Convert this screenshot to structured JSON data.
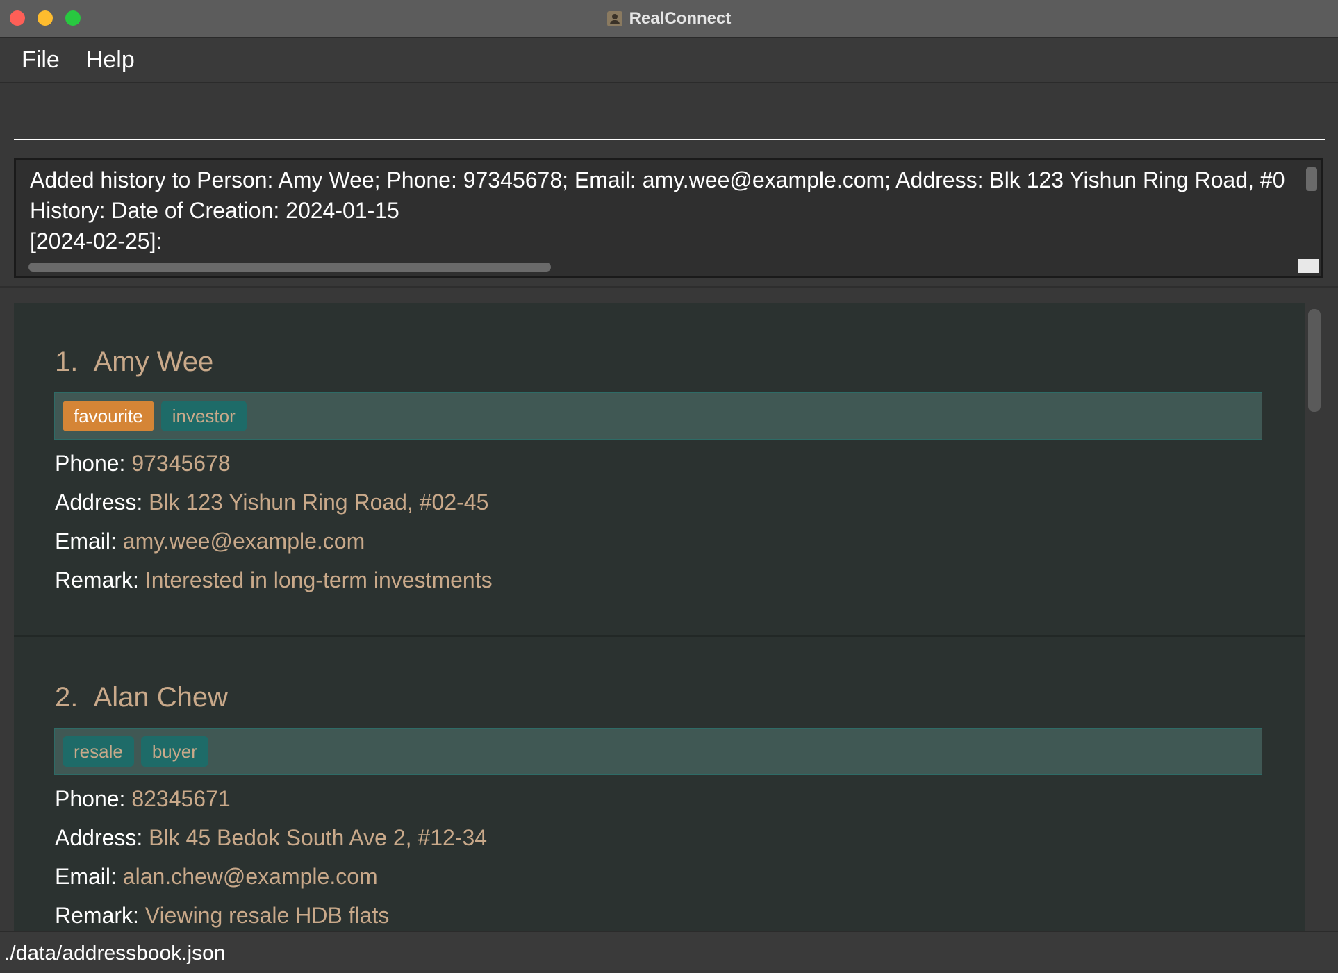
{
  "window": {
    "title": "RealConnect"
  },
  "menu": {
    "items": [
      "File",
      "Help"
    ]
  },
  "command_box": {
    "value": "",
    "placeholder": ""
  },
  "result": {
    "lines": [
      "Added history to Person: Amy Wee; Phone: 97345678; Email: amy.wee@example.com; Address: Blk 123 Yishun Ring Road, #0",
      "History: Date of Creation: 2024-01-15",
      "[2024-02-25]:"
    ]
  },
  "labels": {
    "phone": "Phone:",
    "address": "Address:",
    "email": "Email:",
    "remark": "Remark:"
  },
  "persons": [
    {
      "index": "1.",
      "name": "Amy Wee",
      "tags": [
        {
          "label": "favourite",
          "color": "#d58536"
        },
        {
          "label": "investor",
          "color": "#1e6b68"
        }
      ],
      "phone": "97345678",
      "address": "Blk 123 Yishun Ring Road, #02-45",
      "email": "amy.wee@example.com",
      "remark": "Interested in long-term investments"
    },
    {
      "index": "2.",
      "name": "Alan Chew",
      "tags": [
        {
          "label": "resale",
          "color": "#1e6b68"
        },
        {
          "label": "buyer",
          "color": "#1e6b68"
        }
      ],
      "phone": "82345671",
      "address": "Blk 45 Bedok South Ave 2, #12-34",
      "email": "alan.chew@example.com",
      "remark": "Viewing resale HDB flats"
    }
  ],
  "status_bar": {
    "path": "./data/addressbook.json"
  },
  "colors": {
    "accent_text": "#c9a98a",
    "card_background": "#2b3230",
    "tag_favourite": "#d58536",
    "tag_default": "#1e6b68"
  }
}
